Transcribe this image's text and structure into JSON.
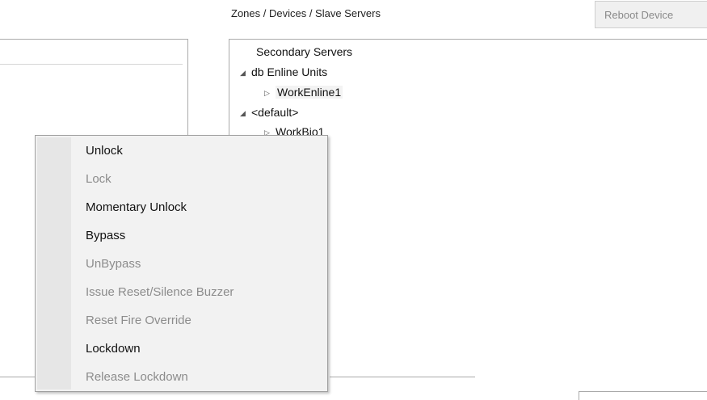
{
  "breadcrumb": "Zones / Devices / Slave Servers",
  "reboot_button": "Reboot Device",
  "tree": {
    "root_label": "Secondary Servers",
    "nodes": [
      {
        "label": "db Enline Units",
        "expander": "◢",
        "expanded": true
      },
      {
        "label": "WorkEnline1",
        "expander": "▷",
        "expanded": false,
        "selected": true
      },
      {
        "label": "<default>",
        "expander": "◢",
        "expanded": true
      },
      {
        "label": "WorkBio1",
        "expander": "▷",
        "expanded": false
      }
    ]
  },
  "context_menu": {
    "items": [
      {
        "label": "Unlock",
        "enabled": true
      },
      {
        "label": "Lock",
        "enabled": false
      },
      {
        "label": "Momentary Unlock",
        "enabled": true
      },
      {
        "label": "Bypass",
        "enabled": true
      },
      {
        "label": "UnBypass",
        "enabled": false
      },
      {
        "label": "Issue Reset/Silence Buzzer",
        "enabled": false
      },
      {
        "label": "Reset Fire Override",
        "enabled": false
      },
      {
        "label": "Lockdown",
        "enabled": true
      },
      {
        "label": "Release Lockdown",
        "enabled": false
      }
    ]
  }
}
